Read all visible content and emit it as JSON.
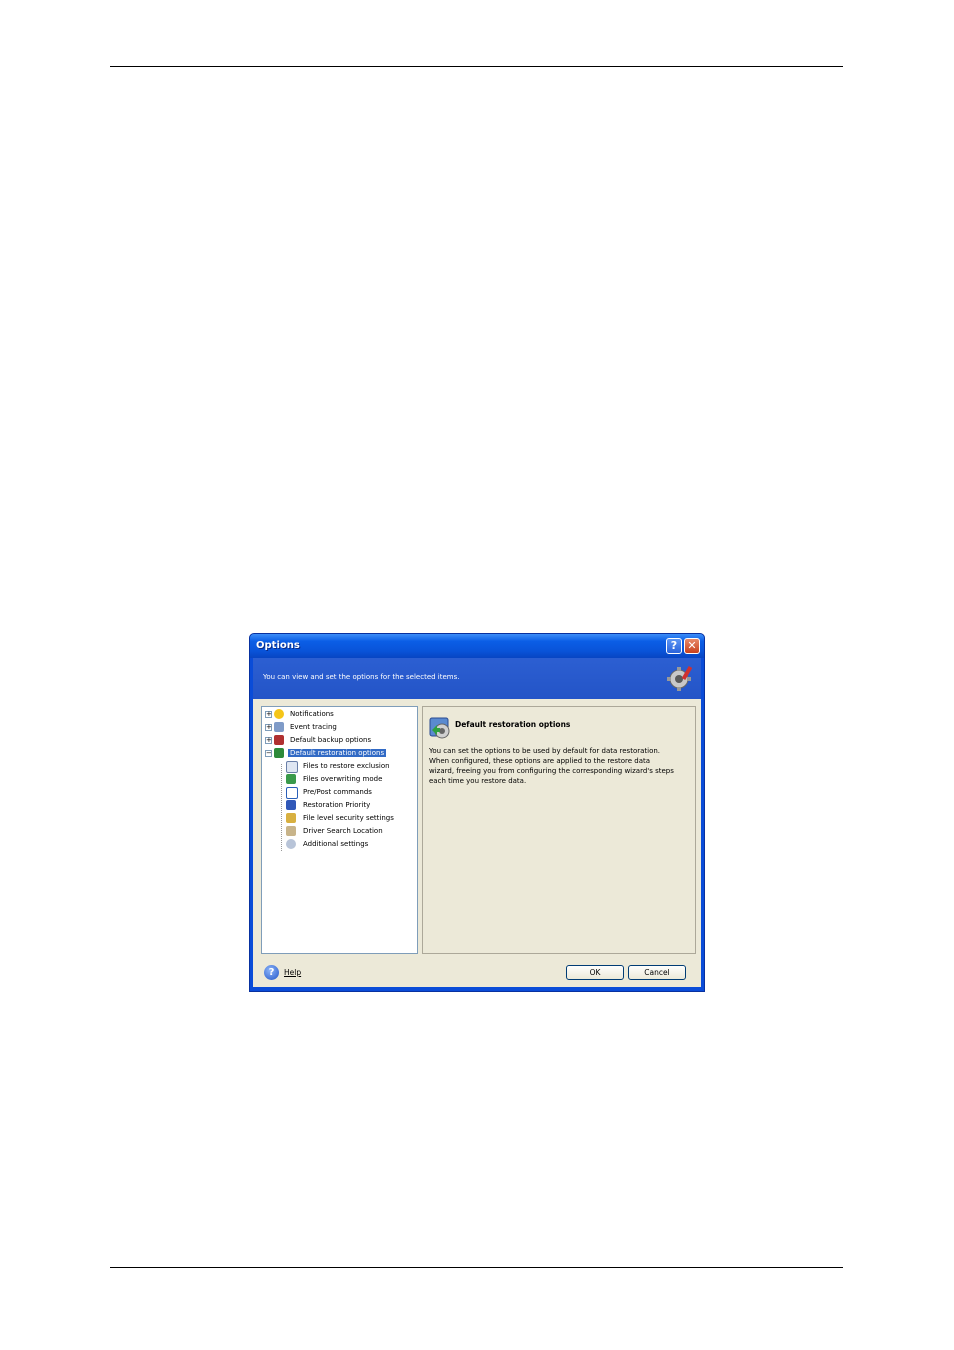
{
  "window": {
    "title": "Options"
  },
  "header": {
    "text": "You can view and set the options for the selected items."
  },
  "tree": {
    "items": [
      {
        "label": "Notifications",
        "icon": "notifications-icon"
      },
      {
        "label": "Event tracing",
        "icon": "event-tracing-icon"
      },
      {
        "label": "Default backup options",
        "icon": "backup-options-icon"
      },
      {
        "label": "Default restoration options",
        "icon": "restoration-options-icon"
      }
    ],
    "children": [
      {
        "label": "Files to restore exclusion",
        "icon": "filter-icon"
      },
      {
        "label": "Files overwriting mode",
        "icon": "overwrite-icon"
      },
      {
        "label": "Pre/Post commands",
        "icon": "commands-icon"
      },
      {
        "label": "Restoration Priority",
        "icon": "priority-icon"
      },
      {
        "label": "File level security settings",
        "icon": "security-icon"
      },
      {
        "label": "Driver Search Location",
        "icon": "driver-search-icon"
      },
      {
        "label": "Additional settings",
        "icon": "settings-icon"
      }
    ]
  },
  "panel": {
    "title": "Default restoration options",
    "description_lines": [
      "You can set the options to be used by default for data restoration.",
      "When configured, these options are applied to the restore data",
      "wizard, freeing you from configuring the corresponding wizard's steps",
      "each time you restore data."
    ]
  },
  "footer": {
    "help_label": "Help",
    "ok_label": "OK",
    "cancel_label": "Cancel"
  }
}
